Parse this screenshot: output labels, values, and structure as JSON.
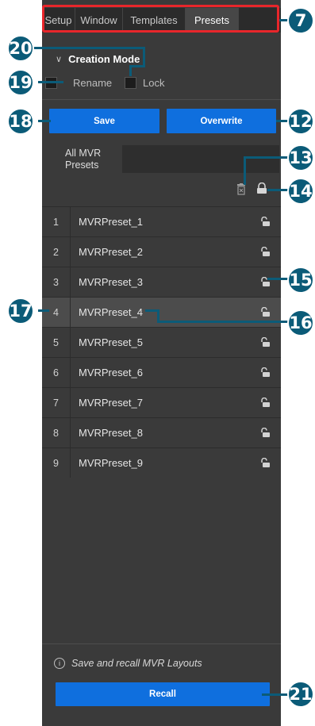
{
  "tabs": [
    {
      "label": "Setup",
      "active": false
    },
    {
      "label": "Window",
      "active": false
    },
    {
      "label": "Templates",
      "active": false
    },
    {
      "label": "Presets",
      "active": true
    }
  ],
  "creation_mode": {
    "title": "Creation Mode",
    "rename_label": "Rename",
    "lock_label": "Lock"
  },
  "buttons": {
    "save": "Save",
    "overwrite": "Overwrite",
    "recall": "Recall"
  },
  "subtab": {
    "label": "All MVR Presets"
  },
  "presets": [
    {
      "num": "1",
      "name": "MVRPreset_1"
    },
    {
      "num": "2",
      "name": "MVRPreset_2"
    },
    {
      "num": "3",
      "name": "MVRPreset_3"
    },
    {
      "num": "4",
      "name": "MVRPreset_4",
      "selected": true
    },
    {
      "num": "5",
      "name": "MVRPreset_5"
    },
    {
      "num": "6",
      "name": "MVRPreset_6"
    },
    {
      "num": "7",
      "name": "MVRPreset_7"
    },
    {
      "num": "8",
      "name": "MVRPreset_8"
    },
    {
      "num": "9",
      "name": "MVRPreset_9"
    }
  ],
  "footer": {
    "info_text": "Save and recall MVR Layouts"
  },
  "callouts": {
    "c7": "7",
    "c12": "12",
    "c13": "13",
    "c14": "14",
    "c15": "15",
    "c16": "16",
    "c17": "17",
    "c18": "18",
    "c19": "19",
    "c20": "20",
    "c21": "21"
  },
  "icons": {
    "lock_open": "unlock-icon",
    "trash": "trash-icon",
    "lock_all": "lock-all-icon",
    "info": "info-icon",
    "chevron": "chevron-down-icon"
  },
  "colors": {
    "accent": "#0f6fde",
    "callout": "#0b5b78",
    "highlight": "#e8262b",
    "panel": "#3a3a3a"
  }
}
